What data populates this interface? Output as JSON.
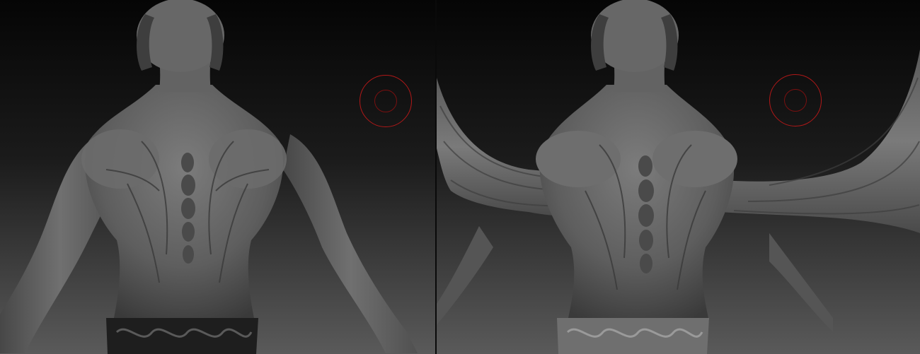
{
  "app": {
    "name": "",
    "panels": [
      {
        "id": "before",
        "description_label": ""
      },
      {
        "id": "after",
        "description_label": ""
      }
    ]
  },
  "colors": {
    "background_top": "#050505",
    "background_bottom": "#5a5a5a",
    "sculpt_base": "#6e6e6e",
    "sculpt_shadow": "#2c2c2c",
    "sculpt_highlight": "#9a9a9a",
    "belt_dark": "#1e1e1e",
    "belt_light": "#8a8a8a",
    "brush_cursor": "#b01818"
  },
  "icons": {
    "brush_cursor": "brush-cursor-icon"
  }
}
